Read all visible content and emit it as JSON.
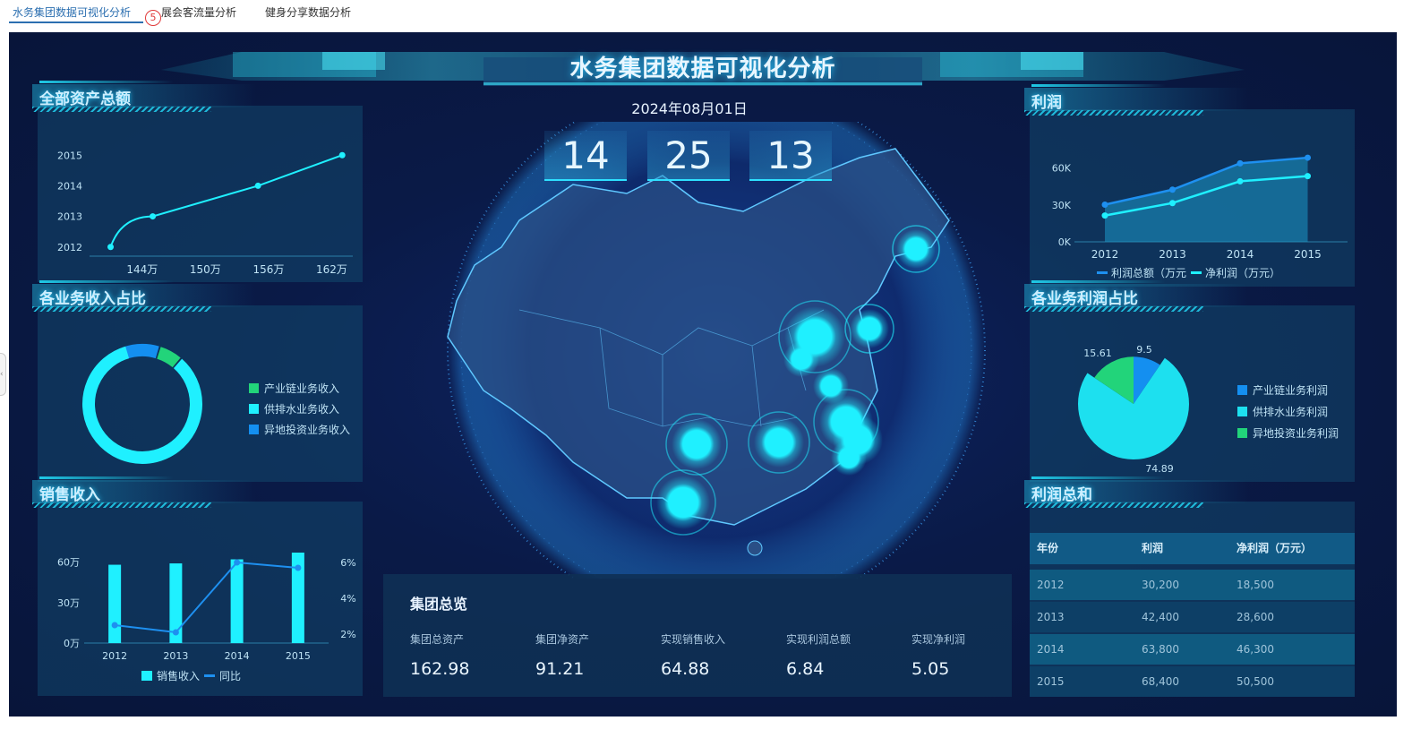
{
  "tabs": [
    {
      "label": "水务集团数据可视化分析",
      "active": true
    },
    {
      "label": "展会客流量分析",
      "active": false
    },
    {
      "label": "健身分享数据分析",
      "active": false
    }
  ],
  "tab_badge": "5",
  "side_handle_icon": "chevron-left-icon",
  "dashboard": {
    "title": "水务集团数据可视化分析",
    "date": "2024年08月01日",
    "clock": [
      "14",
      "25",
      "13"
    ]
  },
  "colors": {
    "accent": "#1ff0ff",
    "panel": "#12486e",
    "bg": "#0a1a47",
    "green": "#22d47a",
    "blue": "#148ff0",
    "cyan": "#1de0ef"
  },
  "assets_panel": {
    "title": "全部资产总额",
    "chart_data": {
      "type": "line",
      "x": [
        "144万",
        "150万",
        "156万",
        "162万"
      ],
      "y_ticks": [
        "2012",
        "2013",
        "2014",
        "2015"
      ],
      "points": [
        {
          "x": 141,
          "y": 2012
        },
        {
          "x": 145,
          "y": 2013
        },
        {
          "x": 155,
          "y": 2014
        },
        {
          "x": 163,
          "y": 2015
        }
      ],
      "xlim": [
        139,
        164
      ],
      "ylim": [
        2011.7,
        2015.3
      ]
    }
  },
  "income_share": {
    "title": "各业务收入占比",
    "chart_data": {
      "type": "pie",
      "donut": true,
      "slices": [
        {
          "name": "产业链业务收入",
          "value": 6,
          "color": "#22d47a"
        },
        {
          "name": "供排水业务收入",
          "value": 84,
          "color": "#1ff0ff"
        },
        {
          "name": "异地投资业务收入",
          "value": 10,
          "color": "#148ff0"
        }
      ]
    }
  },
  "sales": {
    "title": "销售收入",
    "chart_data": {
      "type": "bar",
      "categories": [
        "2012",
        "2013",
        "2014",
        "2015"
      ],
      "series": [
        {
          "name": "销售收入",
          "values": [
            58,
            59,
            62,
            67
          ],
          "axis": "left"
        },
        {
          "name": "同比",
          "values": [
            2.5,
            2.1,
            6.0,
            5.7
          ],
          "axis": "right"
        }
      ],
      "left_ticks": [
        "0万",
        "30万",
        "60万"
      ],
      "right_ticks": [
        "2%",
        "4%",
        "6%"
      ],
      "ylim_left": [
        0,
        65
      ],
      "ylim_right": [
        1.5,
        6.4
      ]
    }
  },
  "profit": {
    "title": "利润",
    "chart_data": {
      "type": "area",
      "categories": [
        "2012",
        "2013",
        "2014",
        "2015"
      ],
      "series": [
        {
          "name": "利润总额（万元",
          "values": [
            30200,
            42400,
            63800,
            68400
          ]
        },
        {
          "name": "净利润（万元）",
          "values": [
            18500,
            28600,
            46300,
            50500
          ]
        }
      ],
      "y_ticks": [
        "0K",
        "30K",
        "60K"
      ],
      "ylim": [
        0,
        75000
      ]
    }
  },
  "profit_share": {
    "title": "各业务利润占比",
    "chart_data": {
      "type": "pie",
      "slices": [
        {
          "name": "产业链业务利润",
          "value": 9.5,
          "color": "#148ff0",
          "label": "9.5"
        },
        {
          "name": "供排水业务利润",
          "value": 74.89,
          "color": "#1de0ef",
          "label": "74.89"
        },
        {
          "name": "异地投资业务利润",
          "value": 15.61,
          "color": "#22d47a",
          "label": "15.61"
        }
      ]
    }
  },
  "profit_total": {
    "title": "利润总和",
    "chart_data": {
      "type": "table",
      "headers": [
        "年份",
        "利润",
        "净利润（万元）"
      ],
      "rows": [
        [
          "2012",
          "30,200",
          "18,500"
        ],
        [
          "2013",
          "42,400",
          "28,600"
        ],
        [
          "2014",
          "63,800",
          "46,300"
        ],
        [
          "2015",
          "68,400",
          "50,500"
        ]
      ]
    }
  },
  "overview": {
    "title": "集团总览",
    "items": [
      {
        "label": "集团总资产",
        "value": "162.98"
      },
      {
        "label": "集团净资产",
        "value": "91.21"
      },
      {
        "label": "实现销售收入",
        "value": "64.88"
      },
      {
        "label": "实现利润总额",
        "value": "6.84"
      },
      {
        "label": "实现净利润",
        "value": "5.05"
      }
    ]
  }
}
